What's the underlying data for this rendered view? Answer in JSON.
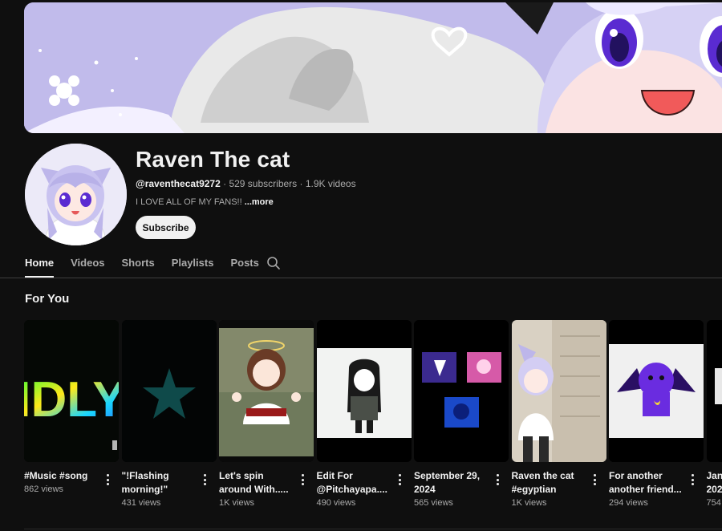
{
  "colors": {
    "background": "#0f0f0f",
    "text_primary": "#f1f1f1",
    "text_secondary": "#aaaaaa",
    "button_bg": "#f1f1f1"
  },
  "channel": {
    "name": "Raven The cat",
    "handle": "@raventhecat9272",
    "subscribers": "529 subscribers",
    "separator": "·",
    "videos": "1.9K videos",
    "description": "I LOVE ALL OF MY FANS!!",
    "more_label": "...more",
    "subscribe_label": "Subscribe"
  },
  "tabs": [
    {
      "label": "Home",
      "active": true
    },
    {
      "label": "Videos"
    },
    {
      "label": "Shorts"
    },
    {
      "label": "Playlists"
    },
    {
      "label": "Posts"
    }
  ],
  "search_icon": "search-icon",
  "section": {
    "title": "For You"
  },
  "shorts": [
    {
      "title": "#Music #song",
      "views": "862 views"
    },
    {
      "title": "\"!Flashing morning!\"",
      "views": "431 views"
    },
    {
      "title": "Let's spin around With.....",
      "views": "1K views"
    },
    {
      "title": "Edit For @Pitchayapa....",
      "views": "490 views"
    },
    {
      "title": "September 29, 2024",
      "views": "565 views"
    },
    {
      "title": "Raven the cat #egyptian",
      "views": "1K views"
    },
    {
      "title": "For another another friend...",
      "views": "294 views"
    },
    {
      "title": "Jan 202",
      "views": "754"
    }
  ],
  "thumb_text": {
    "idly": "IDLY"
  }
}
